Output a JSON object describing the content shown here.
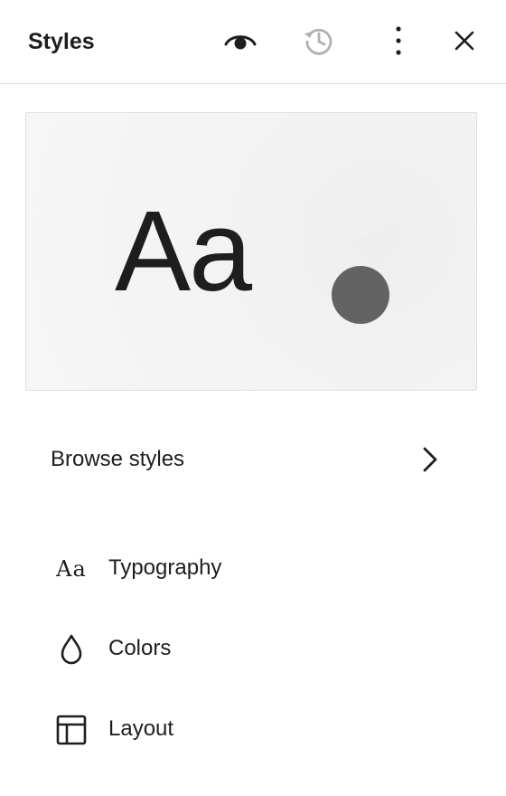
{
  "header": {
    "title": "Styles",
    "preview_icon": "eye-icon",
    "revisions_icon": "history-icon",
    "options_icon": "more-vertical-icon",
    "close_icon": "close-icon"
  },
  "preview": {
    "sample_text": "Aa",
    "swatch_colors": [
      "#f0f0f0",
      "#636363"
    ]
  },
  "browse": {
    "label": "Browse styles",
    "icon": "chevron-right-icon"
  },
  "nav": {
    "items": [
      {
        "label": "Typography",
        "icon": "typography-icon",
        "icon_text": "Aa"
      },
      {
        "label": "Colors",
        "icon": "droplet-icon"
      },
      {
        "label": "Layout",
        "icon": "layout-icon"
      }
    ]
  }
}
